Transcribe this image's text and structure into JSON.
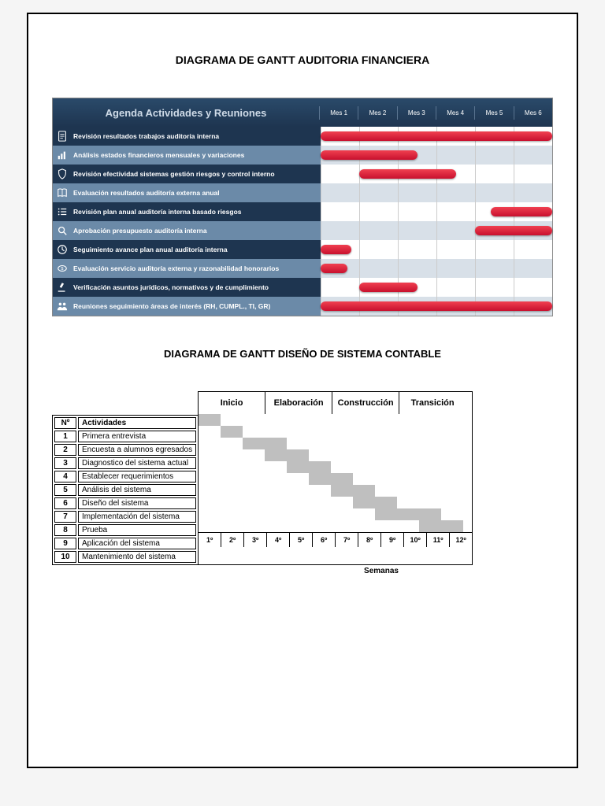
{
  "title1": "DIAGRAMA DE GANTT AUDITORIA FINANCIERA",
  "title2": "DIAGRAMA DE GANTT DISEÑO DE SISTEMA CONTABLE",
  "agenda": {
    "header": "Agenda Actividades y Reuniones",
    "months": [
      "Mes 1",
      "Mes 2",
      "Mes 3",
      "Mes 4",
      "Mes 5",
      "Mes 6"
    ],
    "rows": [
      {
        "icon": "doc",
        "label": "Revisión resultados trabajos auditoría interna",
        "bars": [
          [
            0,
            6
          ]
        ]
      },
      {
        "icon": "chart",
        "label": "Análisis estados financieros mensuales y variaciones",
        "bars": [
          [
            0,
            2.5
          ]
        ]
      },
      {
        "icon": "shield",
        "label": "Revisión efectividad sistemas gestión riesgos y control interno",
        "bars": [
          [
            1,
            3.5
          ]
        ]
      },
      {
        "icon": "book",
        "label": "Evaluación resultados auditoría externa anual",
        "bars": []
      },
      {
        "icon": "list",
        "label": "Revisión plan anual auditoría interna basado riesgos",
        "bars": [
          [
            4.4,
            6
          ]
        ]
      },
      {
        "icon": "search",
        "label": "Aprobación presupuesto auditoría interna",
        "bars": [
          [
            4,
            6
          ]
        ]
      },
      {
        "icon": "clock",
        "label": "Seguimiento avance plan anual auditoría interna",
        "bars": [
          [
            0,
            0.8
          ]
        ]
      },
      {
        "icon": "money",
        "label": "Evaluación servicio auditoría externa y razonabilidad honorarios",
        "bars": [
          [
            0,
            0.7
          ]
        ]
      },
      {
        "icon": "gavel",
        "label": "Verificación asuntos jurídicos, normativos y de cumplimiento",
        "bars": [
          [
            1,
            2.5
          ]
        ]
      },
      {
        "icon": "people",
        "label": "Reuniones seguimiento áreas de interés (RH, CUMPL., TI, GR)",
        "bars": [
          [
            0,
            6
          ]
        ]
      }
    ]
  },
  "simple": {
    "headers": {
      "num": "Nº",
      "act": "Actividades"
    },
    "phases": [
      {
        "label": "Inicio",
        "cols": 3
      },
      {
        "label": "Elaboración",
        "cols": 3
      },
      {
        "label": "Construcción",
        "cols": 3
      },
      {
        "label": "Transición",
        "cols": 3
      }
    ],
    "weeks": [
      "1º",
      "2º",
      "3º",
      "4º",
      "5º",
      "6º",
      "7º",
      "8º",
      "9º",
      "10º",
      "11º",
      "12º"
    ],
    "footer": "Semanas",
    "activities": [
      {
        "n": "1",
        "label": "Primera entrevista",
        "start": 0,
        "end": 1
      },
      {
        "n": "2",
        "label": "Encuesta a alumnos egresados",
        "start": 1,
        "end": 2
      },
      {
        "n": "3",
        "label": "Diagnostico del sistema actual",
        "start": 2,
        "end": 4
      },
      {
        "n": "4",
        "label": "Establecer requerimientos",
        "start": 3,
        "end": 5
      },
      {
        "n": "5",
        "label": "Análisis del sistema",
        "start": 4,
        "end": 6
      },
      {
        "n": "6",
        "label": "Diseño del sistema",
        "start": 5,
        "end": 7
      },
      {
        "n": "7",
        "label": "Implementación del sistema",
        "start": 6,
        "end": 8
      },
      {
        "n": "8",
        "label": "Prueba",
        "start": 7,
        "end": 9
      },
      {
        "n": "9",
        "label": "Aplicación del sistema",
        "start": 8,
        "end": 11
      },
      {
        "n": "10",
        "label": "Mantenimiento del sistema",
        "start": 10,
        "end": 12
      }
    ]
  },
  "chart_data": [
    {
      "type": "gantt",
      "title": "Agenda Actividades y Reuniones",
      "x_unit": "Mes",
      "x_range": [
        1,
        6
      ],
      "tasks": [
        {
          "name": "Revisión resultados trabajos auditoría interna",
          "segments": [
            [
              1,
              6
            ]
          ]
        },
        {
          "name": "Análisis estados financieros mensuales y variaciones",
          "segments": [
            [
              1,
              3
            ]
          ]
        },
        {
          "name": "Revisión efectividad sistemas gestión riesgos y control interno",
          "segments": [
            [
              2,
              4
            ]
          ]
        },
        {
          "name": "Evaluación resultados auditoría externa anual",
          "segments": []
        },
        {
          "name": "Revisión plan anual auditoría interna basado riesgos",
          "segments": [
            [
              5,
              6
            ]
          ]
        },
        {
          "name": "Aprobación presupuesto auditoría interna",
          "segments": [
            [
              5,
              6
            ]
          ]
        },
        {
          "name": "Seguimiento avance plan anual auditoría interna",
          "segments": [
            [
              1,
              1
            ]
          ]
        },
        {
          "name": "Evaluación servicio auditoría externa y razonabilidad honorarios",
          "segments": [
            [
              1,
              1
            ]
          ]
        },
        {
          "name": "Verificación asuntos jurídicos, normativos y de cumplimiento",
          "segments": [
            [
              2,
              3
            ]
          ]
        },
        {
          "name": "Reuniones seguimiento áreas de interés (RH, CUMPL., TI, GR)",
          "segments": [
            [
              1,
              6
            ]
          ]
        }
      ]
    },
    {
      "type": "gantt",
      "title": "Diseño de Sistema Contable",
      "x_unit": "Semana",
      "x_range": [
        1,
        12
      ],
      "phases": [
        {
          "name": "Inicio",
          "weeks": [
            1,
            3
          ]
        },
        {
          "name": "Elaboración",
          "weeks": [
            4,
            6
          ]
        },
        {
          "name": "Construcción",
          "weeks": [
            7,
            9
          ]
        },
        {
          "name": "Transición",
          "weeks": [
            10,
            12
          ]
        }
      ],
      "tasks": [
        {
          "name": "Primera entrevista",
          "segments": [
            [
              1,
              1
            ]
          ]
        },
        {
          "name": "Encuesta a alumnos egresados",
          "segments": [
            [
              2,
              2
            ]
          ]
        },
        {
          "name": "Diagnostico del sistema actual",
          "segments": [
            [
              3,
              4
            ]
          ]
        },
        {
          "name": "Establecer requerimientos",
          "segments": [
            [
              4,
              5
            ]
          ]
        },
        {
          "name": "Análisis del sistema",
          "segments": [
            [
              5,
              6
            ]
          ]
        },
        {
          "name": "Diseño del sistema",
          "segments": [
            [
              6,
              7
            ]
          ]
        },
        {
          "name": "Implementación del sistema",
          "segments": [
            [
              7,
              8
            ]
          ]
        },
        {
          "name": "Prueba",
          "segments": [
            [
              8,
              9
            ]
          ]
        },
        {
          "name": "Aplicación del sistema",
          "segments": [
            [
              9,
              11
            ]
          ]
        },
        {
          "name": "Mantenimiento del sistema",
          "segments": [
            [
              11,
              12
            ]
          ]
        }
      ]
    }
  ]
}
